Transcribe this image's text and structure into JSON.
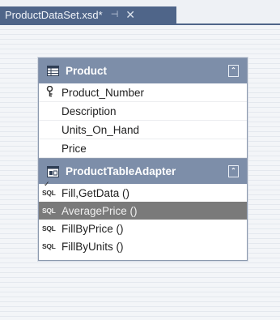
{
  "tab": {
    "title": "ProductDataSet.xsd*",
    "pin_glyph": "⊣",
    "close_glyph": "✕"
  },
  "table": {
    "name": "Product",
    "icon": "table-icon",
    "collapse_glyph": "⌃",
    "columns": [
      {
        "name": "Product_Number",
        "is_key": true
      },
      {
        "name": "Description",
        "is_key": false
      },
      {
        "name": "Units_On_Hand",
        "is_key": false
      },
      {
        "name": "Price",
        "is_key": false
      }
    ]
  },
  "adapter": {
    "name": "ProductTableAdapter",
    "icon": "table-adapter-icon",
    "collapse_glyph": "⌃",
    "methods": [
      {
        "sql_label": "SQL",
        "name": "Fill,GetData ()",
        "selected": false
      },
      {
        "sql_label": "SQL",
        "name": "AveragePrice ()",
        "selected": true
      },
      {
        "sql_label": "SQL",
        "name": "FillByPrice ()",
        "selected": false
      },
      {
        "sql_label": "SQL",
        "name": "FillByUnits ()",
        "selected": false
      }
    ]
  },
  "colors": {
    "tab_active": "#4f6589",
    "header": "#7d8ea9",
    "selection": "#7a7a7a"
  }
}
